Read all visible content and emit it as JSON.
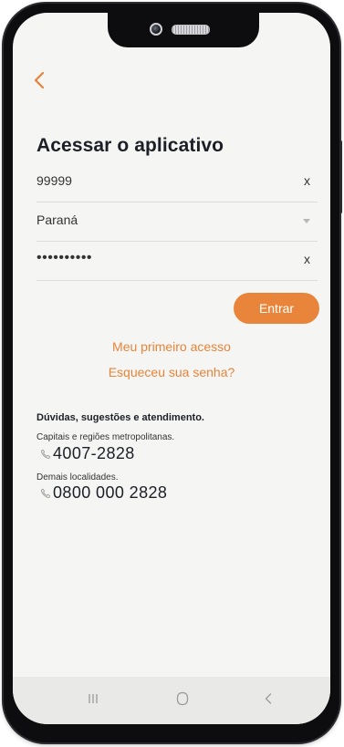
{
  "screen": {
    "title": "Acessar o aplicativo"
  },
  "form": {
    "user_value": "99999",
    "user_clear": "x",
    "state_value": "Paraná",
    "password_value": "••••••••••",
    "password_clear": "x",
    "submit_label": "Entrar"
  },
  "links": {
    "first_access": "Meu primeiro acesso",
    "forgot_password": "Esqueceu sua senha?"
  },
  "help": {
    "title": "Dúvidas, sugestões e atendimento.",
    "capitals_label": "Capitais e regiões metropolitanas.",
    "capitals_phone": "4007-2828",
    "other_label": "Demais localidades.",
    "other_phone": "0800 000 2828"
  },
  "icons": {
    "back": "chevron-left-icon",
    "dropdown": "caret-down-icon",
    "phone": "phone-icon",
    "nav_recent": "recent-apps-icon",
    "nav_home": "home-icon",
    "nav_back": "nav-back-icon"
  },
  "colors": {
    "accent": "#e8853b",
    "text": "#1d1f27",
    "background": "#f5f5f3"
  }
}
